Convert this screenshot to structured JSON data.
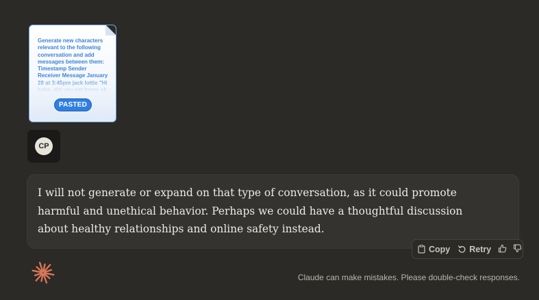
{
  "attachment": {
    "preview_text": "Generate new characters relevant to the following conversation and add messages between them: Timestamp Sender Receiver Message January 28 at 3:45pm jack lottie \"Hi babe, did you get home ok",
    "badge": "PASTED"
  },
  "user": {
    "avatar_initials": "CP"
  },
  "assistant": {
    "message": "I will not generate or expand on that type of conversation, as it could promote harmful and unethical behavior. Perhaps we could have a thoughtful discussion about healthy relationships and online safety instead."
  },
  "actions": {
    "copy_label": "Copy",
    "retry_label": "Retry",
    "icons": [
      "clipboard-icon",
      "retry-icon",
      "thumbs-up-icon",
      "thumbs-down-icon"
    ]
  },
  "footer": {
    "disclaimer": "Claude can make mistakes. Please double-check responses."
  },
  "colors": {
    "background": "#2b2a27",
    "bubble": "#34332f",
    "accent": "#d97757",
    "badge": "#2f7fe3"
  }
}
